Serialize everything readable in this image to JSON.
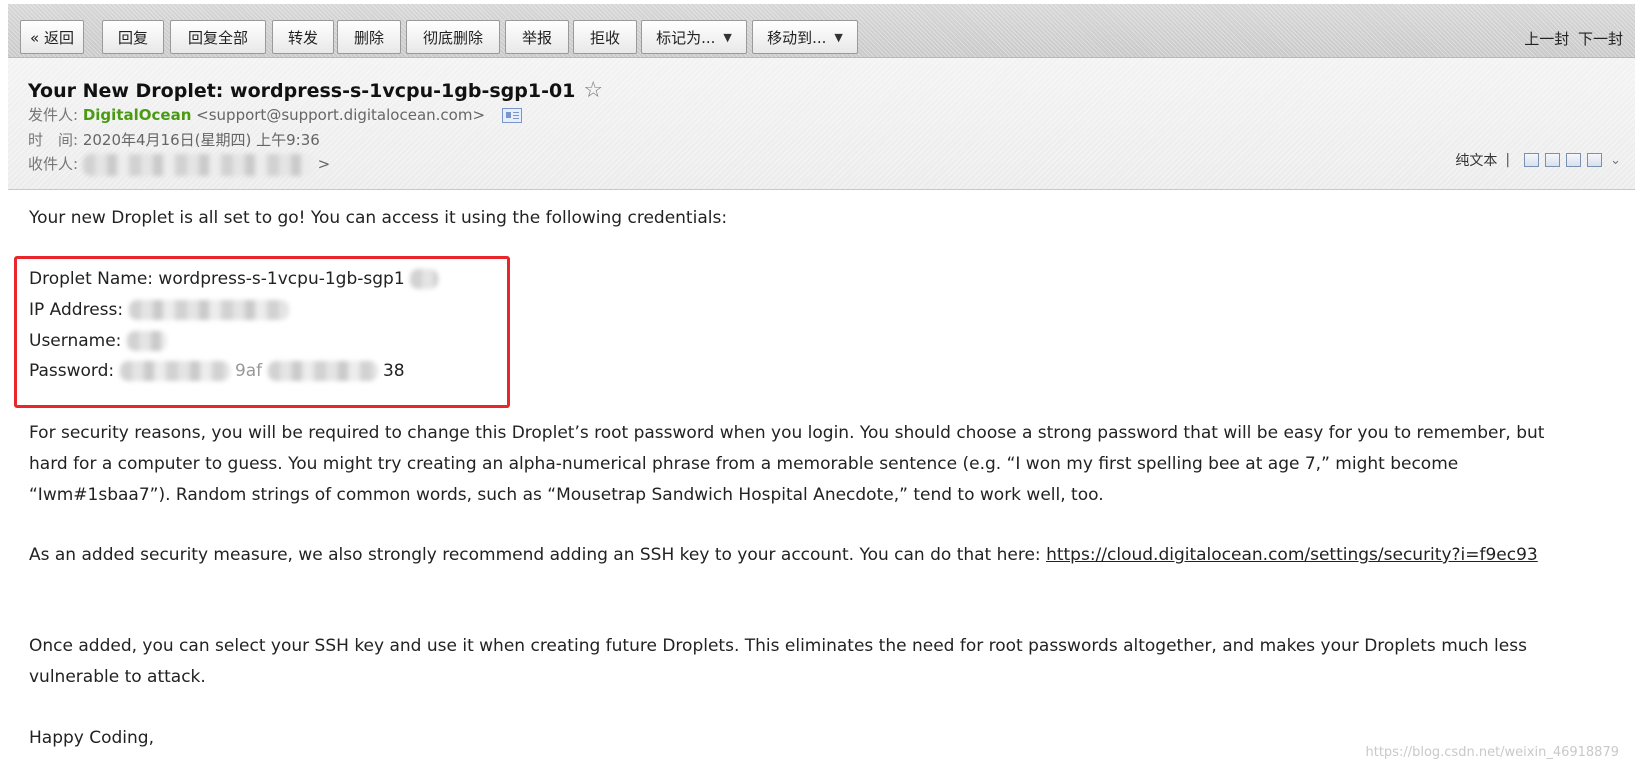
{
  "toolbar": {
    "back": "« 返回",
    "reply": "回复",
    "reply_all": "回复全部",
    "forward": "转发",
    "delete": "删除",
    "delete_forever": "彻底删除",
    "report": "举报",
    "reject": "拒收",
    "mark_as": "标记为...",
    "move_to": "移动到...",
    "prev": "上一封",
    "next": "下一封"
  },
  "header": {
    "subject": "Your New Droplet: wordpress-s-1vcpu-1gb-sgp1-01",
    "from_label": "发件人:",
    "from_name": "DigitalOcean",
    "from_email": "<support@support.digitalocean.com>",
    "time_label": "时　间:",
    "time_value": "2020年4月16日(星期四) 上午9:36",
    "to_label": "收件人:",
    "to_suffix": ">",
    "plain_text": "纯文本",
    "sep": "|",
    "expand_glyph": "⌄"
  },
  "body": {
    "intro": "Your new Droplet is all set to go! You can access it using the following credentials:",
    "credentials": {
      "name_label": "Droplet Name: wordpress-s-1vcpu-1gb-sgp1",
      "ip_label": "IP Address: ",
      "user_label": "Username: ",
      "pass_label": "Password: ",
      "pass_mid": "9af",
      "pass_end": "38"
    },
    "security": "For security reasons, you will be required to change this Droplet’s root password when you login. You should choose a strong password that will be easy for you to remember, but hard for a computer to guess. You might try creating an alpha-numerical phrase from a memorable sentence (e.g. “I won my first spelling bee at age 7,” might become “Iwm#1sbaa7”). Random strings of common words, such as “Mousetrap Sandwich Hospital Anecdote,” tend to work well, too.",
    "ssh_text": "As an added security measure, we also strongly recommend adding an SSH key to your account. You can do that here: ",
    "ssh_link": "https://cloud.digitalocean.com/settings/security?i=f9ec93",
    "once_added": "Once added, you can select your SSH key and use it when creating future Droplets. This eliminates the need for root passwords altogether, and makes your Droplets much less vulnerable to attack.",
    "closing": "Happy Coding,"
  },
  "watermark": "https://blog.csdn.net/weixin_46918879",
  "colors": {
    "sender_green": "#4a9a14",
    "highlight_red": "#e8262b"
  }
}
